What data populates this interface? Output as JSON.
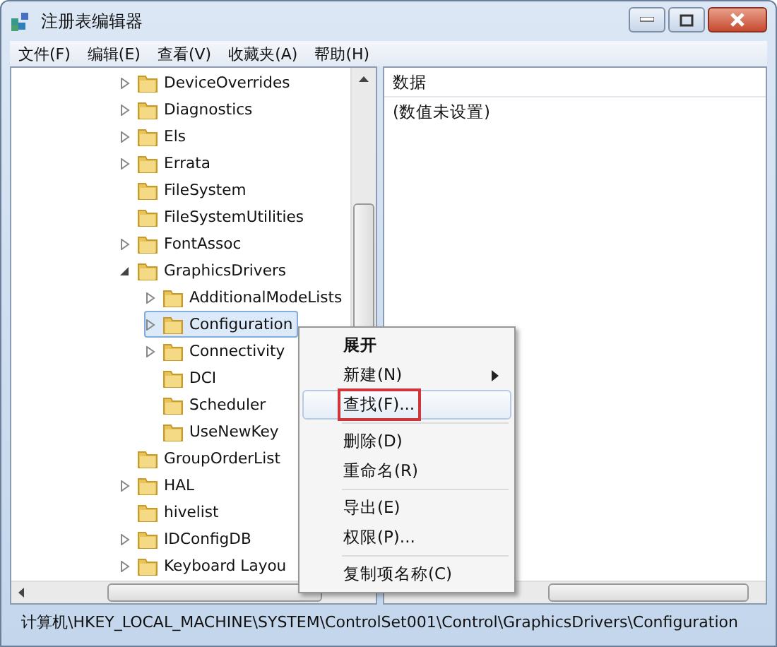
{
  "window": {
    "title": "注册表编辑器"
  },
  "menu_bar": [
    "文件(F)",
    "编辑(E)",
    "查看(V)",
    "收藏夹(A)",
    "帮助(H)"
  ],
  "tree": [
    {
      "label": "DeviceOverrides",
      "expandable": true,
      "expanded": false,
      "selected": false
    },
    {
      "label": "Diagnostics",
      "expandable": true,
      "expanded": false,
      "selected": false
    },
    {
      "label": "Els",
      "expandable": true,
      "expanded": false,
      "selected": false
    },
    {
      "label": "Errata",
      "expandable": true,
      "expanded": false,
      "selected": false
    },
    {
      "label": "FileSystem",
      "expandable": false,
      "selected": false
    },
    {
      "label": "FileSystemUtilities",
      "expandable": false,
      "selected": false
    },
    {
      "label": "FontAssoc",
      "expandable": true,
      "expanded": false,
      "selected": false
    },
    {
      "label": "GraphicsDrivers",
      "expandable": true,
      "expanded": true,
      "selected": false,
      "children": [
        {
          "label": "AdditionalModeLists",
          "expandable": true,
          "expanded": false,
          "selected": false
        },
        {
          "label": "Configuration",
          "expandable": true,
          "expanded": false,
          "selected": true
        },
        {
          "label": "Connectivity",
          "expandable": true,
          "expanded": false,
          "selected": false
        },
        {
          "label": "DCI",
          "expandable": false,
          "selected": false
        },
        {
          "label": "Scheduler",
          "expandable": false,
          "selected": false
        },
        {
          "label": "UseNewKey",
          "expandable": false,
          "selected": false
        }
      ]
    },
    {
      "label": "GroupOrderList",
      "expandable": false,
      "selected": false
    },
    {
      "label": "HAL",
      "expandable": true,
      "expanded": false,
      "selected": false
    },
    {
      "label": "hivelist",
      "expandable": false,
      "selected": false
    },
    {
      "label": "IDConfigDB",
      "expandable": true,
      "expanded": false,
      "selected": false
    },
    {
      "label": "Keyboard Layou",
      "expandable": true,
      "expanded": false,
      "selected": false
    }
  ],
  "values_pane": {
    "column_header": "数据",
    "value": "(数值未设置)"
  },
  "context_menu": [
    [
      {
        "label": "展开",
        "bold": true,
        "submenu": false,
        "selected": false,
        "outlined": false
      },
      {
        "label": "新建(N)",
        "bold": false,
        "submenu": true,
        "selected": false,
        "outlined": false
      },
      {
        "label": "查找(F)...",
        "bold": false,
        "submenu": false,
        "selected": true,
        "outlined": true
      }
    ],
    [
      {
        "label": "删除(D)",
        "bold": false,
        "submenu": false,
        "selected": false,
        "outlined": false
      },
      {
        "label": "重命名(R)",
        "bold": false,
        "submenu": false,
        "selected": false,
        "outlined": false
      }
    ],
    [
      {
        "label": "导出(E)",
        "bold": false,
        "submenu": false,
        "selected": false,
        "outlined": false
      },
      {
        "label": "权限(P)...",
        "bold": false,
        "submenu": false,
        "selected": false,
        "outlined": false
      }
    ],
    [
      {
        "label": "复制项名称(C)",
        "bold": false,
        "submenu": false,
        "selected": false,
        "outlined": false
      }
    ]
  ],
  "status_bar": "计算机\\HKEY_LOCAL_MACHINE\\SYSTEM\\ControlSet001\\Control\\GraphicsDrivers\\Configuration"
}
